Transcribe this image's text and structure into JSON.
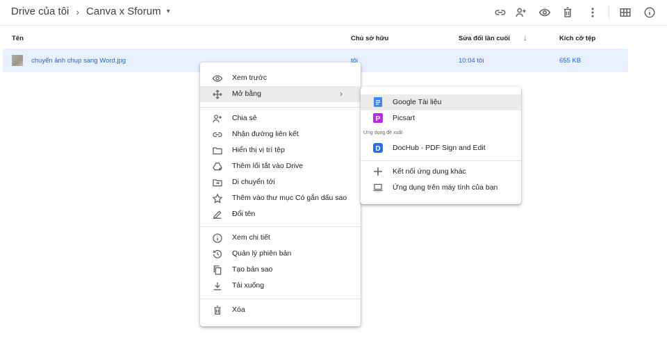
{
  "breadcrumb": {
    "root": "Drive của tôi",
    "separator": "›",
    "current": "Canva x Sforum",
    "caret": "▾"
  },
  "toolbar": {
    "icons": [
      "link-icon",
      "add-person-icon",
      "eye-icon",
      "trash-icon",
      "more-vert-icon",
      "grid-view-icon",
      "info-icon"
    ]
  },
  "columns": {
    "name": "Tên",
    "owner": "Chủ sở hữu",
    "modified": "Sửa đổi lần cuối",
    "sort_arrow": "↓",
    "size": "Kích cỡ tệp"
  },
  "file": {
    "name": "chuyển ảnh chụp sang Word.jpg",
    "owner": "tôi",
    "modified": "10:04 tôi",
    "size": "655 KB"
  },
  "context_menu": {
    "preview": "Xem trước",
    "open_with": "Mở bằng",
    "open_with_arrow": "›",
    "share": "Chia sẻ",
    "get_link": "Nhận đường liên kết",
    "show_location": "Hiển thị vị trí tệp",
    "add_shortcut": "Thêm lối tắt vào Drive",
    "move_to": "Di chuyển tới",
    "add_starred": "Thêm vào thư mục Có gắn dấu sao",
    "rename": "Đổi tên",
    "view_details": "Xem chi tiết",
    "manage_versions": "Quản lý phiên bản",
    "make_copy": "Tạo bản sao",
    "download": "Tải xuống",
    "remove": "Xóa"
  },
  "submenu": {
    "google_docs": "Google Tài liệu",
    "picsart": "Picsart",
    "suggested_heading": "Ứng dụng đề xuất",
    "dochub": "DocHub - PDF Sign and Edit",
    "connect_more": "Kết nối ứng dụng khác",
    "computer_apps": "Ứng dụng trên máy tính của bạn"
  },
  "colors": {
    "selection": "#e8f0fe",
    "link_blue": "#1967d2",
    "docs_blue": "#4285f4",
    "picsart_purple": "#b42fe0",
    "dochub_blue": "#2e6be6",
    "hover_gray": "#ebebeb"
  }
}
